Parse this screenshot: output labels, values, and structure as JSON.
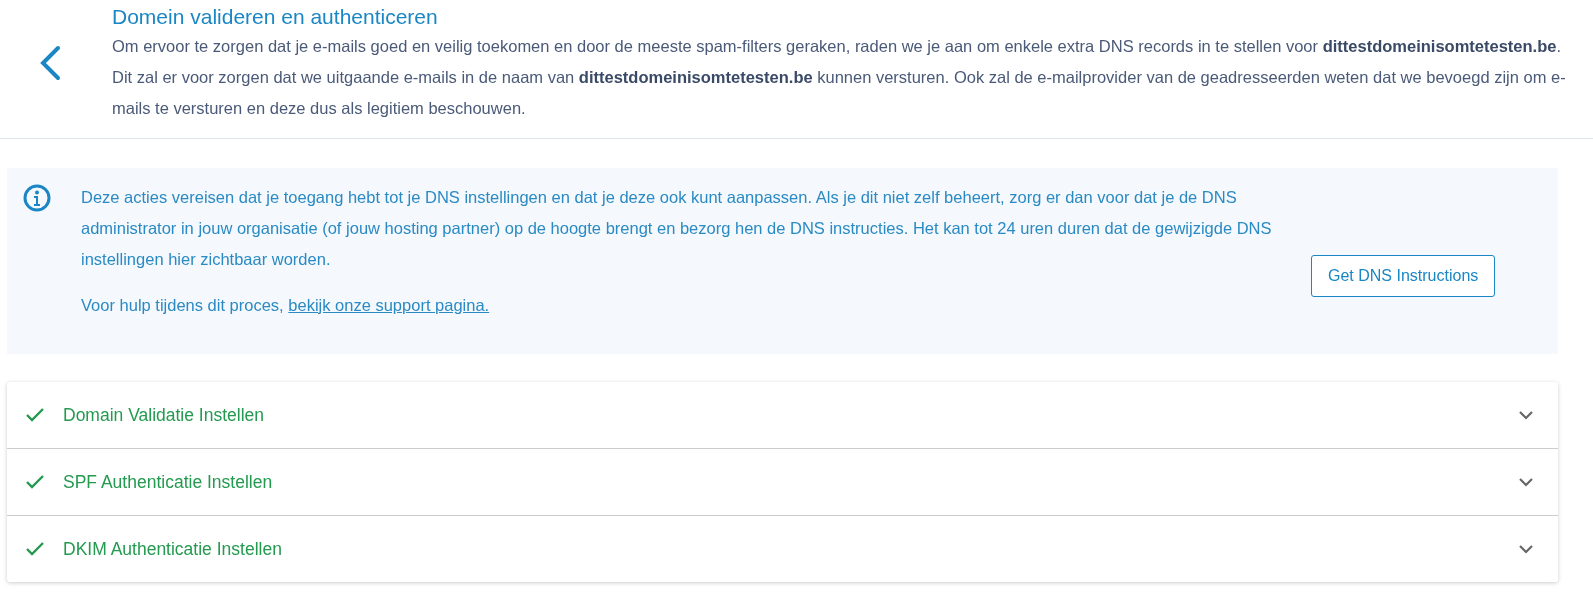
{
  "header": {
    "title": "Domein valideren en authenticeren",
    "description": "Om ervoor te zorgen dat je e-mails goed en veilig toekomen en door de meeste spam-filters geraken, raden we je aan om enkele extra DNS records in te stellen voor **dittestdomeinisomtetesten.be**. Dit zal er voor zorgen dat we uitgaande e-mails in de naam van **dittestdomeinisomtetesten.be** kunnen versturen. Ook zal de e-mailprovider van de geadresseerden weten dat we bevoegd zijn om e-mails te versturen en deze dus als legitiem beschouwen."
  },
  "info": {
    "text": "Deze acties vereisen dat je toegang hebt tot je DNS instellingen en dat je deze ook kunt aanpassen. Als je dit niet zelf beheert, zorg er dan voor dat je de DNS administrator in jouw organisatie (of jouw hosting partner) op de hoogte brengt en bezorg hen de DNS instructies. Het kan tot 24 uren duren dat de gewijzigde DNS instellingen hier zichtbaar worden.",
    "help_text": "Voor hulp tijdens dit proces,",
    "help_link": "bekijk onze support pagina.",
    "button": "Get DNS Instructions"
  },
  "steps": [
    {
      "label": "Domain Validatie Instellen",
      "done": true,
      "expanded": false
    },
    {
      "label": "SPF Authenticatie Instellen",
      "done": true,
      "expanded": false
    },
    {
      "label": "DKIM Authenticatie Instellen",
      "done": true,
      "expanded": false
    }
  ]
}
